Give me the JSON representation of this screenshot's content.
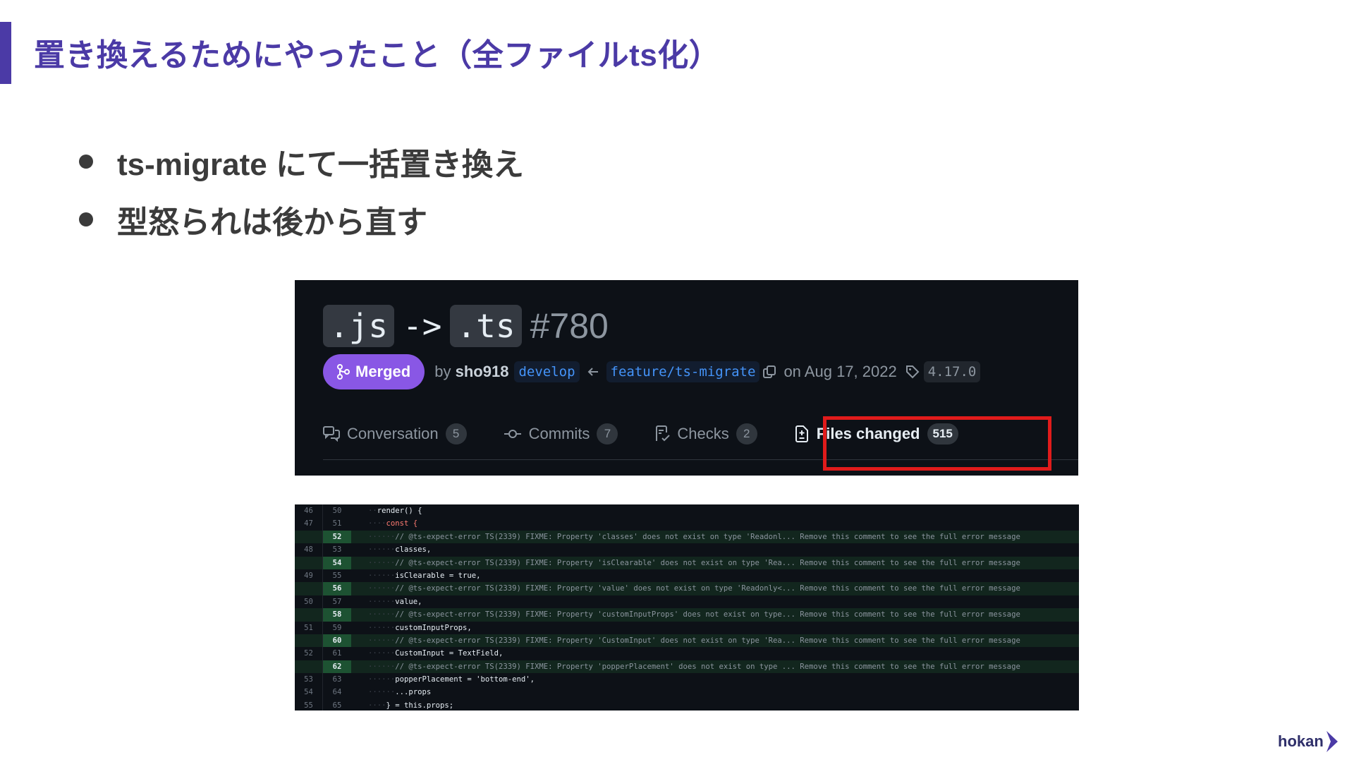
{
  "slide": {
    "title": "置き換えるためにやったこと（全ファイルts化）",
    "bullets": [
      "ts-migrate にて一括置き換え",
      "型怒られは後から直す"
    ],
    "accent_color": "#4b3aa6"
  },
  "pr": {
    "title_code_1": ".js",
    "title_arrow": "->",
    "title_code_2": ".ts",
    "number": "#780",
    "status": "Merged",
    "by_prefix": "by",
    "author": "sho918",
    "base_branch": "develop",
    "head_branch": "feature/ts-migrate",
    "merged_on": "on Aug 17, 2022",
    "tag": "4.17.0",
    "tabs": [
      {
        "label": "Conversation",
        "count": "5",
        "icon": "comment-discussion-icon"
      },
      {
        "label": "Commits",
        "count": "7",
        "icon": "git-commit-icon"
      },
      {
        "label": "Checks",
        "count": "2",
        "icon": "checklist-icon"
      },
      {
        "label": "Files changed",
        "count": "515",
        "icon": "file-diff-icon",
        "active": true
      }
    ],
    "highlight_color": "#e01b1b"
  },
  "diff": {
    "rows": [
      {
        "old": "46",
        "new": "50",
        "indent": "··",
        "code": "render() {",
        "added": false
      },
      {
        "old": "47",
        "new": "51",
        "indent": "····",
        "code": "const {",
        "kw": true,
        "added": false
      },
      {
        "old": "",
        "new": "52",
        "indent": "······",
        "code": "// @ts-expect-error TS(2339) FIXME: Property 'classes' does not exist on type 'Readonl... Remove this comment to see the full error message",
        "comment": true,
        "added": true
      },
      {
        "old": "48",
        "new": "53",
        "indent": "······",
        "code": "classes,",
        "added": false
      },
      {
        "old": "",
        "new": "54",
        "indent": "······",
        "code": "// @ts-expect-error TS(2339) FIXME: Property 'isClearable' does not exist on type 'Rea... Remove this comment to see the full error message",
        "comment": true,
        "added": true
      },
      {
        "old": "49",
        "new": "55",
        "indent": "······",
        "code": "isClearable = true,",
        "added": false
      },
      {
        "old": "",
        "new": "56",
        "indent": "······",
        "code": "// @ts-expect-error TS(2339) FIXME: Property 'value' does not exist on type 'Readonly<... Remove this comment to see the full error message",
        "comment": true,
        "added": true
      },
      {
        "old": "50",
        "new": "57",
        "indent": "······",
        "code": "value,",
        "added": false
      },
      {
        "old": "",
        "new": "58",
        "indent": "······",
        "code": "// @ts-expect-error TS(2339) FIXME: Property 'customInputProps' does not exist on type... Remove this comment to see the full error message",
        "comment": true,
        "added": true
      },
      {
        "old": "51",
        "new": "59",
        "indent": "······",
        "code": "customInputProps,",
        "added": false
      },
      {
        "old": "",
        "new": "60",
        "indent": "······",
        "code": "// @ts-expect-error TS(2339) FIXME: Property 'CustomInput' does not exist on type 'Rea... Remove this comment to see the full error message",
        "comment": true,
        "added": true
      },
      {
        "old": "52",
        "new": "61",
        "indent": "······",
        "code": "CustomInput = TextField,",
        "added": false
      },
      {
        "old": "",
        "new": "62",
        "indent": "······",
        "code": "// @ts-expect-error TS(2339) FIXME: Property 'popperPlacement' does not exist on type ... Remove this comment to see the full error message",
        "comment": true,
        "added": true
      },
      {
        "old": "53",
        "new": "63",
        "indent": "······",
        "code": "popperPlacement = 'bottom-end',",
        "added": false
      },
      {
        "old": "54",
        "new": "64",
        "indent": "······",
        "code": "...props",
        "added": false
      },
      {
        "old": "55",
        "new": "65",
        "indent": "····",
        "code": "} = this.props;",
        "added": false
      }
    ]
  },
  "logo": {
    "text": "hokan"
  }
}
